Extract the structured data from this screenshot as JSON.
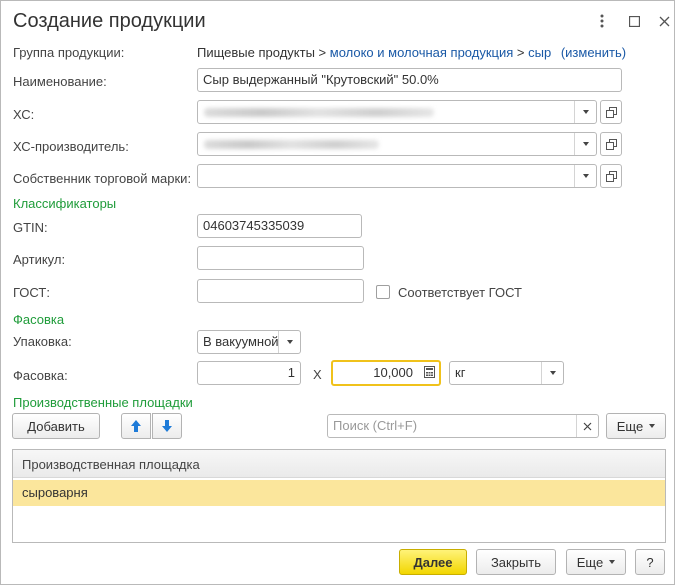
{
  "window": {
    "title": "Создание продукции"
  },
  "form": {
    "group_label": "Группа продукции:",
    "group_path_prefix": "Пищевые продукты >",
    "group_path_link1": "молоко и молочная продукция",
    "group_path_sep": ">",
    "group_path_link2": "сыр",
    "group_change": "(изменить)",
    "name_label": "Наименование:",
    "name_value": "Сыр выдержанный \"Крутовский\" 50.0%",
    "hs_label": "ХС:",
    "hs_producer_label": "ХС-производитель:",
    "trademark_owner_label": "Собственник торговой марки:"
  },
  "classifiers": {
    "section_title": "Классификаторы",
    "gtin_label": "GTIN:",
    "gtin_value": "04603745335039",
    "article_label": "Артикул:",
    "article_value": "",
    "gost_label": "ГОСТ:",
    "gost_value": "",
    "gost_match_label": "Соответствует ГОСТ",
    "gost_match_checked": false
  },
  "packing": {
    "section_title": "Фасовка",
    "package_label": "Упаковка:",
    "package_value": "В вакуумной",
    "packing_label": "Фасовка:",
    "quantity": "1",
    "multiply_sign": "X",
    "amount": "10,000",
    "unit": "кг"
  },
  "sites": {
    "section_title": "Производственные площадки",
    "add_button": "Добавить",
    "search_placeholder": "Поиск (Ctrl+F)",
    "more_button": "Еще",
    "column_header": "Производственная площадка",
    "rows": [
      {
        "name": "сыроварня"
      }
    ]
  },
  "footer": {
    "next_button": "Далее",
    "close_button": "Закрыть",
    "more_button": "Еще",
    "help_button": "?"
  }
}
